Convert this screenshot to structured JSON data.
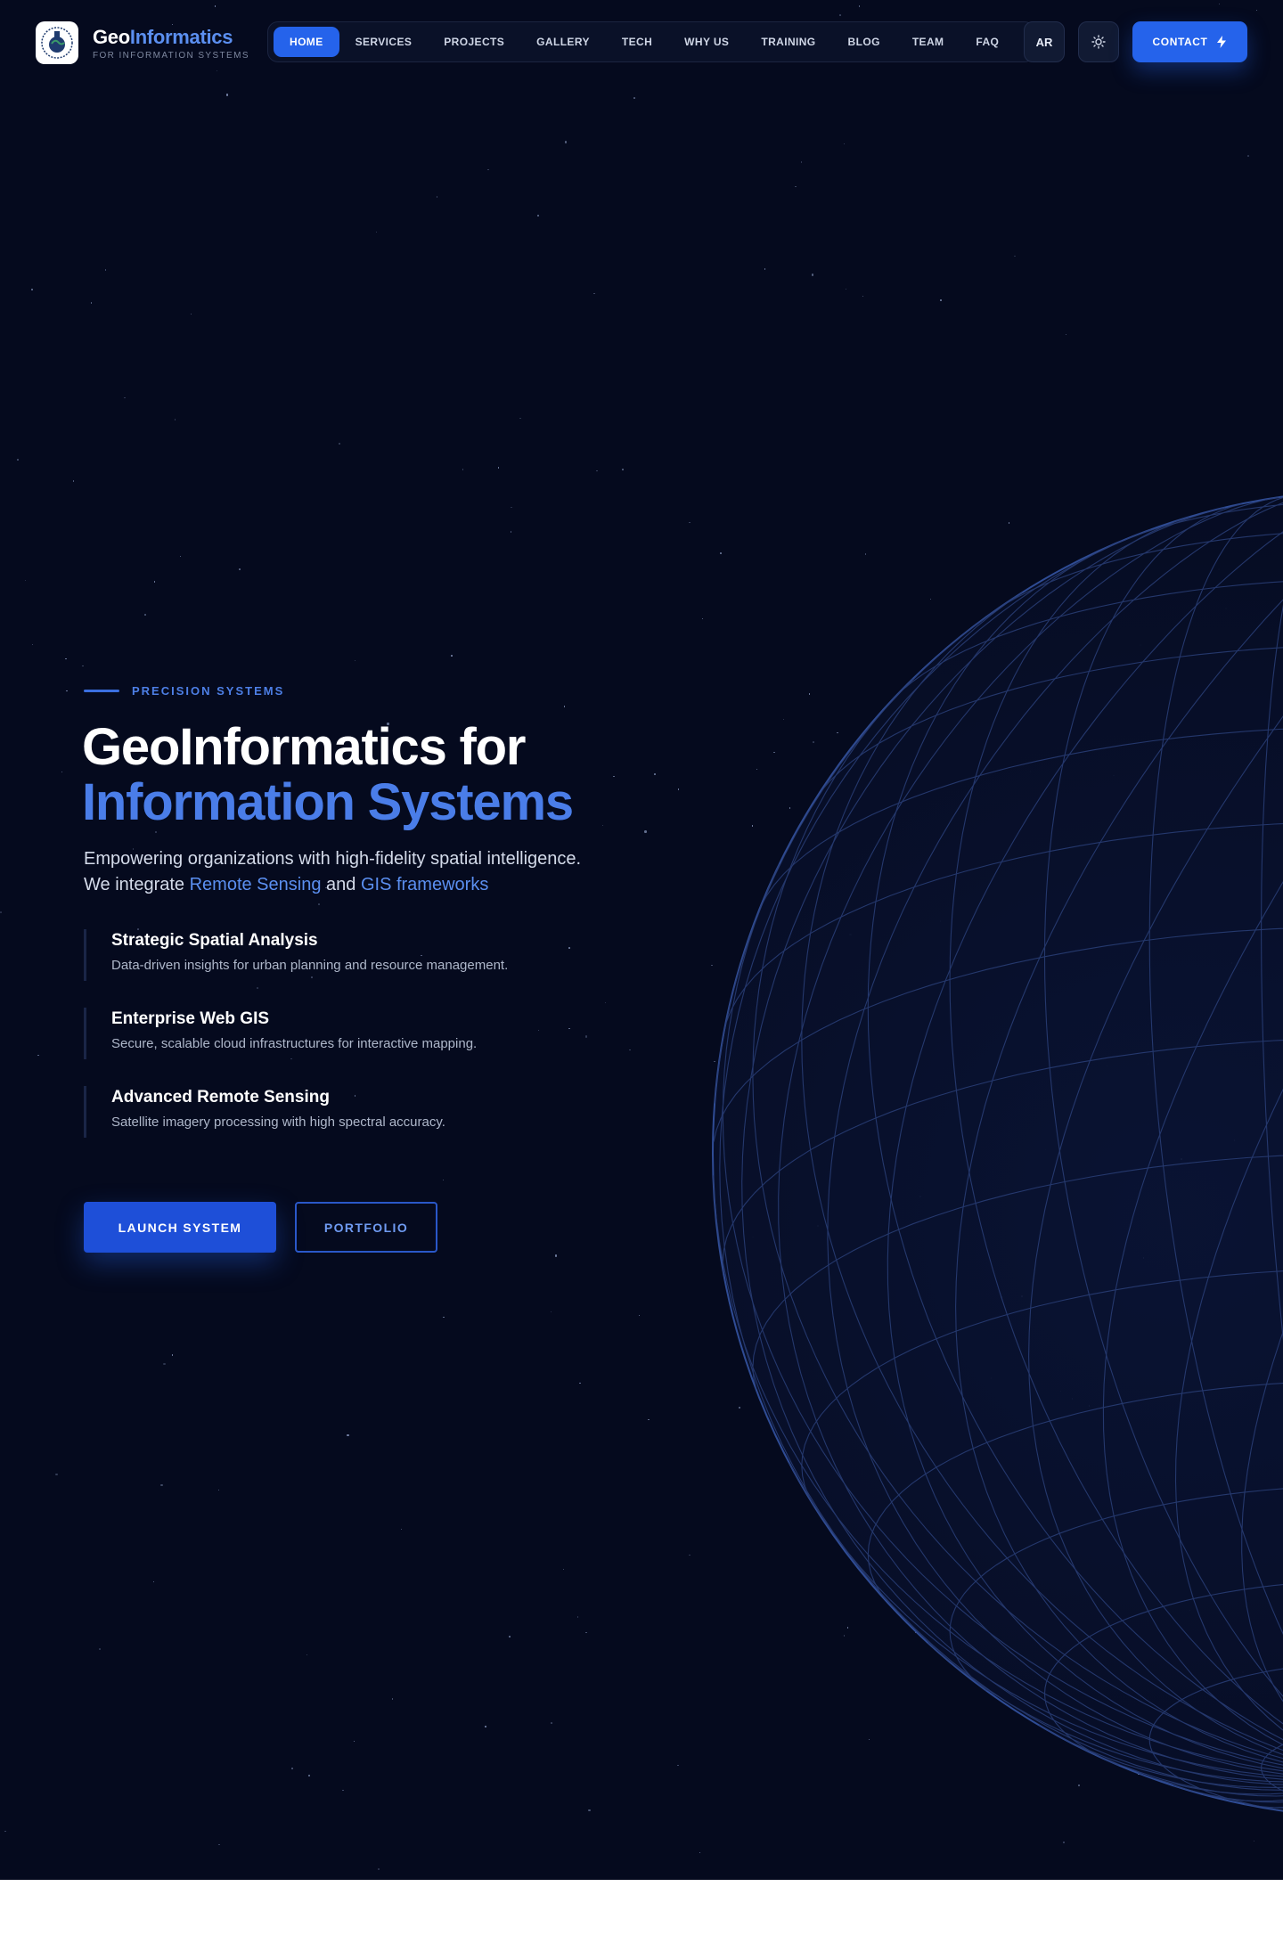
{
  "brand": {
    "name_part1": "Geo",
    "name_part2": "Informatics",
    "tagline": "FOR INFORMATION SYSTEMS"
  },
  "nav": {
    "items": [
      {
        "label": "HOME",
        "active": true
      },
      {
        "label": "SERVICES"
      },
      {
        "label": "PROJECTS"
      },
      {
        "label": "GALLERY"
      },
      {
        "label": "TECH"
      },
      {
        "label": "WHY US"
      },
      {
        "label": "TRAINING"
      },
      {
        "label": "BLOG"
      },
      {
        "label": "TEAM"
      },
      {
        "label": "FAQ"
      }
    ]
  },
  "header_actions": {
    "language_label": "AR",
    "theme_icon": "sun-icon",
    "contact_label": "CONTACT",
    "contact_icon": "lightning-icon"
  },
  "hero": {
    "eyebrow": "PRECISION SYSTEMS",
    "title_line1": "GeoInformatics for",
    "title_line2": "Information Systems",
    "lead_line1": "Empowering organizations with high-fidelity spatial intelligence.",
    "lead_line2_prefix": "We integrate ",
    "lead_highlight1": "Remote Sensing",
    "lead_and": " and ",
    "lead_highlight2": "GIS frameworks",
    "features": [
      {
        "title": "Strategic Spatial Analysis",
        "desc": "Data-driven insights for urban planning and resource management."
      },
      {
        "title": "Enterprise Web GIS",
        "desc": "Secure, scalable cloud infrastructures for interactive mapping."
      },
      {
        "title": "Advanced Remote Sensing",
        "desc": "Satellite imagery processing with high spectral accuracy."
      }
    ],
    "primary_cta": "LAUNCH SYSTEM",
    "secondary_cta": "PORTFOLIO"
  },
  "colors": {
    "background": "#050a1e",
    "accent": "#2563eb",
    "accent_text": "#4a7de8",
    "globe_lines": "#2a3f78"
  }
}
